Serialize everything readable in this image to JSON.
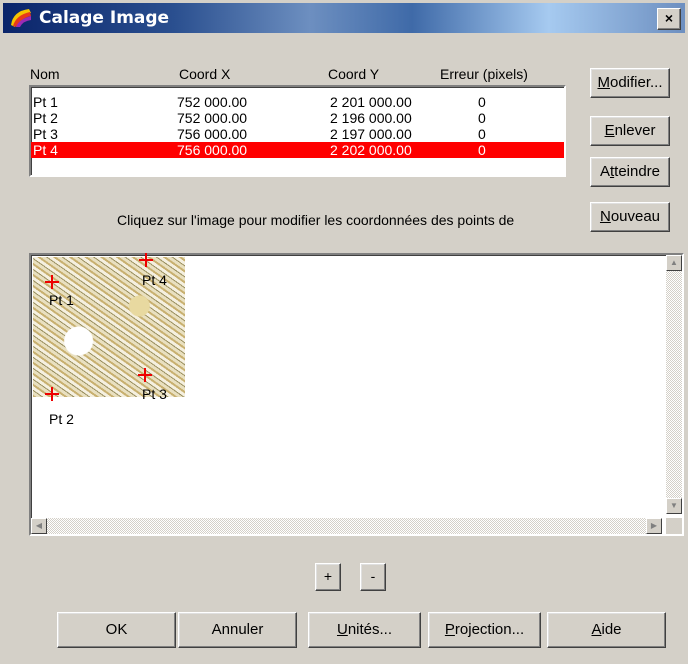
{
  "window": {
    "title": "Calage Image",
    "close_glyph": "×"
  },
  "table": {
    "headers": {
      "nom": "Nom",
      "x": "Coord X",
      "y": "Coord Y",
      "err": "Erreur (pixels)"
    },
    "rows": [
      {
        "nom": "Pt 1",
        "x": "752 000.00",
        "y": "2 201 000.00",
        "err": "0",
        "selected": false
      },
      {
        "nom": "Pt 2",
        "x": "752 000.00",
        "y": "2 196 000.00",
        "err": "0",
        "selected": false
      },
      {
        "nom": "Pt 3",
        "x": "756 000.00",
        "y": "2 197 000.00",
        "err": "0",
        "selected": false
      },
      {
        "nom": "Pt 4",
        "x": "756 000.00",
        "y": "2 202 000.00",
        "err": "0",
        "selected": true
      }
    ]
  },
  "side_buttons": {
    "modifier": {
      "pre": "",
      "key": "M",
      "post": "odifier..."
    },
    "enlever": {
      "pre": "",
      "key": "E",
      "post": "nlever"
    },
    "atteindre": {
      "pre": "A",
      "key": "t",
      "post": "teindre"
    },
    "nouveau": {
      "pre": "",
      "key": "N",
      "post": "ouveau"
    }
  },
  "instruction": "Cliquez sur l'image pour modifier les coordonnées des points de",
  "canvas": {
    "points": [
      {
        "label": "Pt 1"
      },
      {
        "label": "Pt 2"
      },
      {
        "label": "Pt 3"
      },
      {
        "label": "Pt 4"
      }
    ]
  },
  "zoom": {
    "plus": "+",
    "minus": "-"
  },
  "bottom_buttons": {
    "ok": "OK",
    "annuler": "Annuler",
    "unites": {
      "pre": "",
      "key": "U",
      "post": "nités..."
    },
    "projection": {
      "pre": "",
      "key": "P",
      "post": "rojection..."
    },
    "aide": {
      "pre": "",
      "key": "A",
      "post": "ide"
    }
  },
  "colors": {
    "selection": "#ff0000",
    "marker": "#e00000",
    "face": "#d4d0c8"
  },
  "icons": {
    "app": "palette-icon",
    "close": "close-icon",
    "scroll_up": "arrow-up-icon",
    "scroll_down": "arrow-down-icon",
    "scroll_left": "arrow-left-icon",
    "scroll_right": "arrow-right-icon"
  }
}
